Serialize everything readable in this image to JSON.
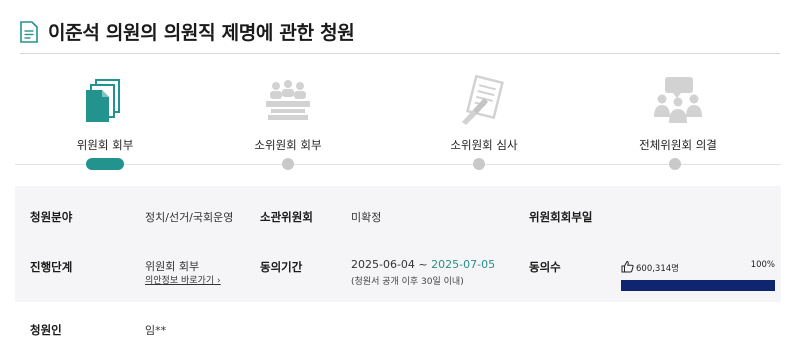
{
  "page_title": "이준석 의원의 의원직 제명에 관한 청원",
  "steps": [
    {
      "label": "위원회 회부",
      "icon": "documents-icon",
      "active": true
    },
    {
      "label": "소위원회 회부",
      "icon": "meeting-icon",
      "active": false
    },
    {
      "label": "소위원회 심사",
      "icon": "review-icon",
      "active": false
    },
    {
      "label": "전체위원회 의결",
      "icon": "discussion-icon",
      "active": false
    }
  ],
  "info": {
    "field_label": "청원분야",
    "field_value": "정치/선거/국회운영",
    "committee_label": "소관위원회",
    "committee_value": "미확정",
    "referral_date_label": "위원회회부일",
    "stage_label": "진행단계",
    "stage_value": "위원회 회부",
    "bill_link": "의안정보 바로가기",
    "period_label": "동의기간",
    "period_start": "2025-06-04 ~ ",
    "period_end": "2025-07-05",
    "period_note": "(청원서 공개 이후 30일 이내)",
    "agree_label": "동의수",
    "agree_count": "600,314명",
    "agree_percent": "100%",
    "agree_fraction": 1.0,
    "petitioner_label": "청원인",
    "petitioner_value": "임**"
  },
  "colors": {
    "accent": "#23938d",
    "progress": "#0f2570",
    "inactive": "#c9c9c9"
  }
}
